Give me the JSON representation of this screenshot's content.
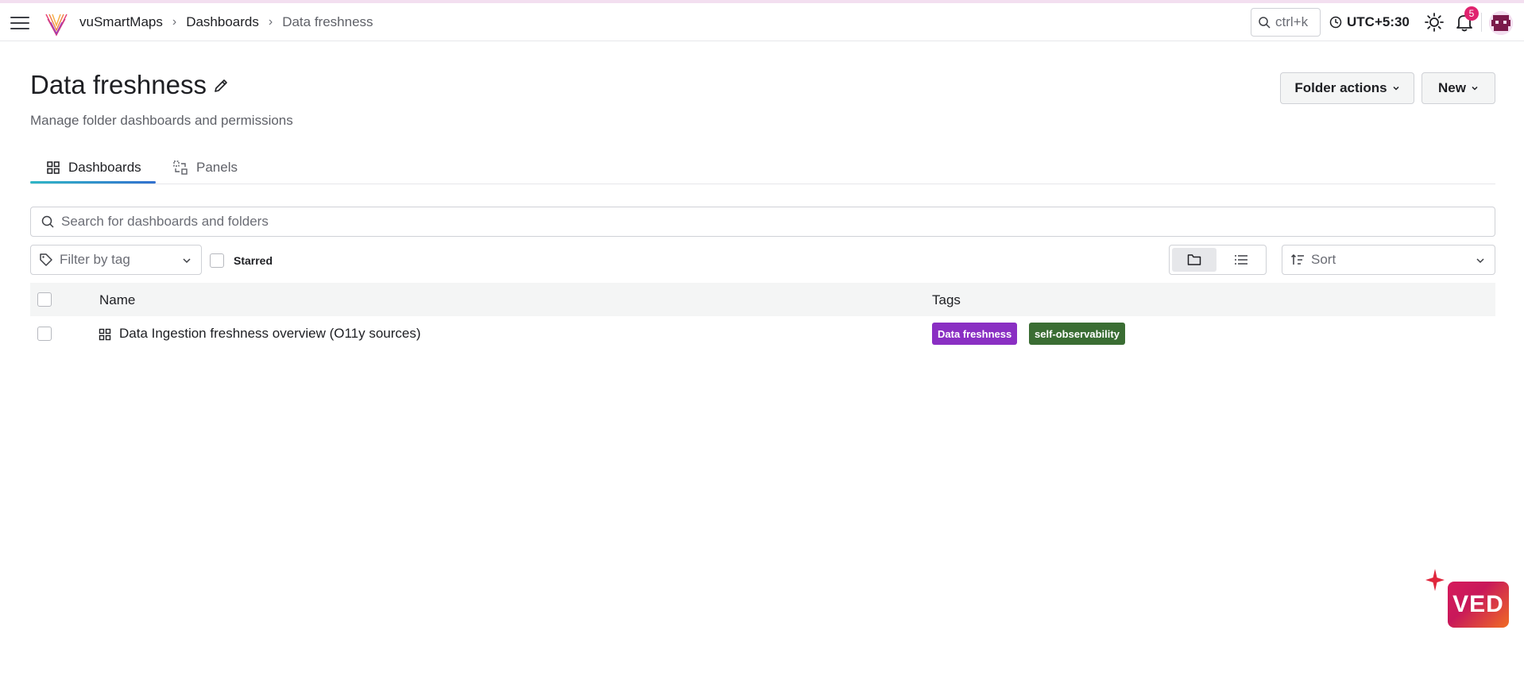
{
  "topbar": {
    "breadcrumbs": [
      "vuSmartMaps",
      "Dashboards",
      "Data freshness"
    ],
    "search_placeholder": "ctrl+k",
    "timezone": "UTC+5:30",
    "notification_count": "5"
  },
  "header": {
    "title": "Data freshness",
    "subtitle": "Manage folder dashboards and permissions",
    "folder_actions_label": "Folder actions",
    "new_label": "New"
  },
  "tabs": [
    {
      "label": "Dashboards",
      "active": true,
      "icon": "grid-icon"
    },
    {
      "label": "Panels",
      "active": false,
      "icon": "panels-icon"
    }
  ],
  "search": {
    "placeholder": "Search for dashboards and folders"
  },
  "filters": {
    "tag_placeholder": "Filter by tag",
    "starred_label": "Starred",
    "sort_label": "Sort",
    "view_mode": "folder"
  },
  "table": {
    "columns": [
      "Name",
      "Tags"
    ],
    "rows": [
      {
        "name": "Data Ingestion freshness overview (O11y sources)",
        "tags": [
          {
            "label": "Data freshness",
            "color": "#8a2fc3"
          },
          {
            "label": "self-observability",
            "color": "#3a6d33"
          }
        ]
      }
    ]
  },
  "assistant": {
    "label": "VED"
  }
}
